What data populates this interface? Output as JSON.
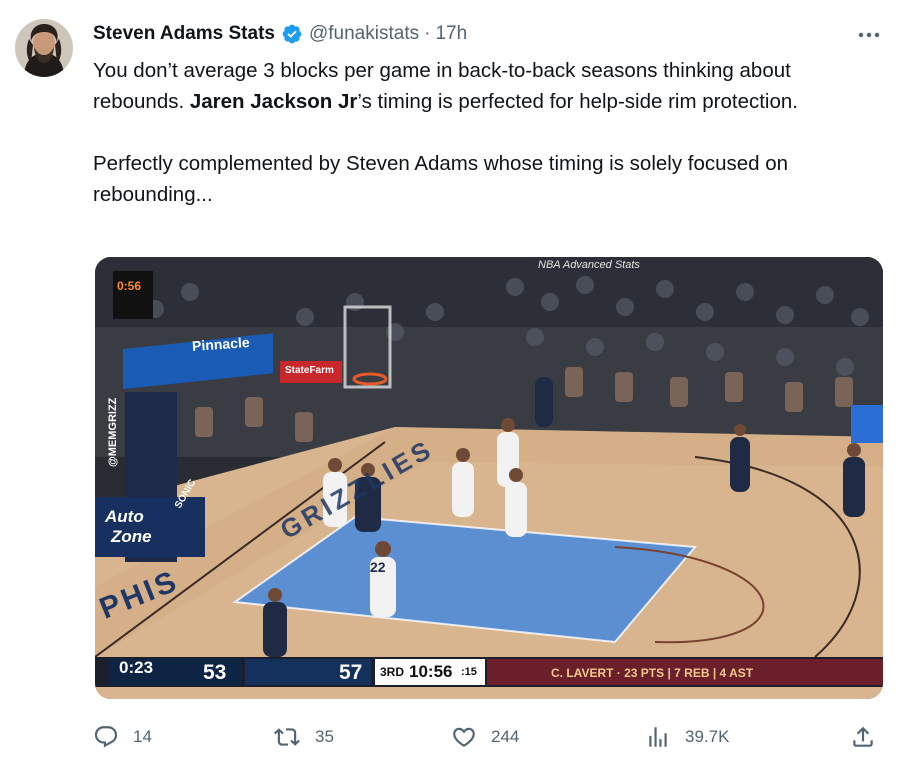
{
  "tweet": {
    "author_name": "Steven Adams Stats",
    "author_handle": "@funakistats",
    "separator": "·",
    "time": "17h",
    "paragraph1_part1": "You don’t average 3 blocks per game in back-to-back seasons thinking about rebounds. ",
    "paragraph1_bold": "Jaren Jackson Jr",
    "paragraph1_part2": "’s timing is perfected for help-side rim protection.",
    "paragraph2": "Perfectly complemented by Steven Adams whose timing is solely focused on rebounding..."
  },
  "media": {
    "watermark": "NBA Advanced Stats",
    "shot_clock": "0:56",
    "banner_pinnacle": "Pinnacle",
    "banner_statefarm": "StateFarm",
    "stanchion_handle": "@MEMGRIZZ",
    "sign_autozone_1": "Auto",
    "sign_autozone_2": "Zone",
    "sign_sonic": "SONIC",
    "baseline_text": "PHIS",
    "court_text": "GRIZZLIES",
    "jersey_number": "22",
    "scoreboard": {
      "game_clock": "0:23",
      "away_score": "53",
      "home_score": "57",
      "quarter": "3RD",
      "period_clock": "10:56",
      "shot_clock": ":15",
      "player_stat": "C. LAVERT · 23 PTS | 7 REB | 4 AST"
    }
  },
  "actions": {
    "replies": "14",
    "retweets": "35",
    "likes": "244",
    "views": "39.7K"
  },
  "colors": {
    "text_primary": "#0f1419",
    "text_secondary": "#536471",
    "verified_blue": "#1d9bf0"
  }
}
